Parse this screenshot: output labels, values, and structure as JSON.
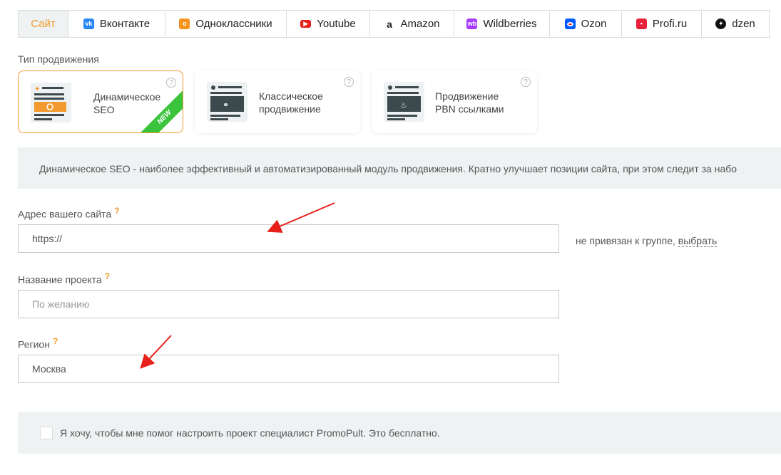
{
  "tabs": [
    {
      "label": "Сайт",
      "icon": "none",
      "active": true
    },
    {
      "label": "Вконтакте",
      "icon": "vk-icon",
      "color": "#2787f5"
    },
    {
      "label": "Одноклассники",
      "icon": "odnoklassniki-icon",
      "color": "#f7931e"
    },
    {
      "label": "Youtube",
      "icon": "youtube-icon",
      "color": "#e8201a"
    },
    {
      "label": "Amazon",
      "icon": "amazon-icon",
      "color": "#222222"
    },
    {
      "label": "Wildberries",
      "icon": "wildberries-icon",
      "color": "#a73afd"
    },
    {
      "label": "Ozon",
      "icon": "ozon-icon",
      "color": "#005bff"
    },
    {
      "label": "Profi.ru",
      "icon": "profi-icon",
      "color": "#e8203a"
    },
    {
      "label": "dzen",
      "icon": "dzen-icon",
      "color": "#111111"
    }
  ],
  "promo_type_label": "Тип продвижения",
  "cards": [
    {
      "label": "Динамическое\nSEO",
      "selected": true,
      "badge": "NEW",
      "help": "?"
    },
    {
      "label": "Классическое\nпродвижение",
      "selected": false,
      "help": "?"
    },
    {
      "label": "Продвижение\nPBN ссылками",
      "selected": false,
      "help": "?"
    }
  ],
  "info_text": "Динамическое SEO - наиболее эффективный и автоматизированный модуль продвижения. Кратно улучшает позиции сайта, при этом следит за набо",
  "site_field": {
    "label": "Адрес вашего сайта",
    "help": "?",
    "value": "https://"
  },
  "group_status": {
    "text": "не привязан к группе,",
    "link": "выбрать"
  },
  "project_field": {
    "label": "Название проекта",
    "help": "?",
    "placeholder": "По желанию"
  },
  "region_field": {
    "label": "Регион",
    "help": "?",
    "value": "Москва"
  },
  "specialist_checkbox": {
    "label": "Я хочу, чтобы мне помог настроить проект специалист PromoPult. Это бесплатно.",
    "checked": false
  },
  "colors": {
    "accent": "#f29a2e",
    "ribbon": "#39c43b",
    "panel": "#eef2f3",
    "arrow": "#e8201a"
  }
}
